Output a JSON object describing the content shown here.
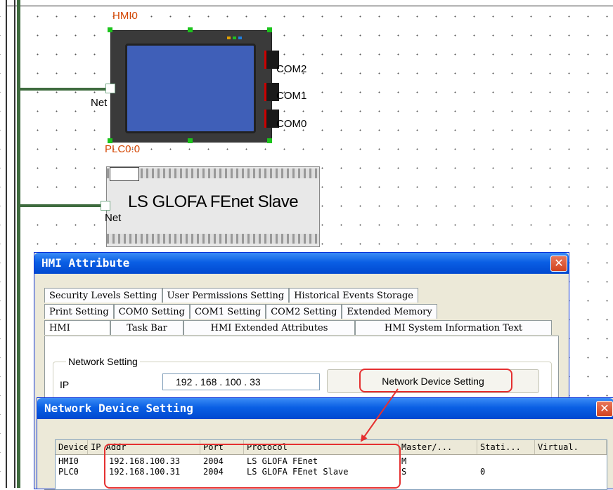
{
  "diagram": {
    "hmi_label": "HMI0",
    "plc_label": "PLC0:0",
    "net_label": "Net",
    "com2_label": "COM2",
    "com1_label": "COM1",
    "com0_label": "COM0",
    "plc_name": "LS GLOFA FEnet Slave",
    "plc_net_label": "Net"
  },
  "hmi_attribute": {
    "title": "HMI Attribute",
    "close_glyph": "✕",
    "tabs_row1": [
      "Security Levels Setting",
      "User Permissions Setting",
      "Historical Events Storage"
    ],
    "tabs_row2": [
      "Print Setting",
      "COM0 Setting",
      "COM1 Setting",
      "COM2 Setting",
      "Extended Memory"
    ],
    "tabs_row3": [
      "HMI",
      "Task Bar",
      "HMI Extended Attributes",
      "HMI System Information Text"
    ],
    "network_setting_label": "Network Setting",
    "ip_label": "IP",
    "ip_value": "192 . 168 . 100 . 33",
    "network_device_button": "Network Device Setting"
  },
  "network_device_setting": {
    "title": "Network Device Setting",
    "close_glyph": "✕",
    "columns": [
      "Device",
      "IP Addr",
      "Port",
      "Protocol",
      "Master/...",
      "Stati...",
      "Virtual."
    ],
    "rows": [
      {
        "device": "HMI0",
        "ip": "192.168.100.33",
        "port": "2004",
        "protocol": "LS GLOFA FEnet",
        "master": "M",
        "station": "",
        "virtual": ""
      },
      {
        "device": "PLC0",
        "ip": "192.168.100.31",
        "port": "2004",
        "protocol": "LS GLOFA FEnet Slave",
        "master": "S",
        "station": "0",
        "virtual": ""
      }
    ]
  },
  "colors": {
    "titlebar": "#0a5fe4",
    "highlight": "#e53030",
    "wire": "#3e6b3e",
    "screen": "#3f5fb8"
  }
}
